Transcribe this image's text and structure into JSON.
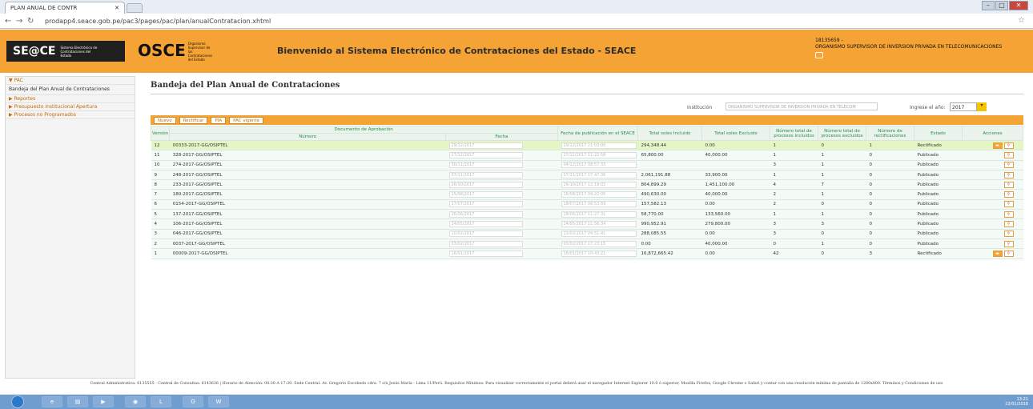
{
  "browser": {
    "tab_title": "PLAN ANUAL DE CONTR",
    "url": "prodapp4.seace.gob.pe/pac3/pages/pac/plan/anualContratacion.xhtml"
  },
  "banner": {
    "seace": "SE@CE",
    "seace_sub": "Sistema Electrónico de Contrataciones del Estado",
    "osce": "OSCE",
    "osce_sub": "Organismo Supervisor de las Contrataciones del Estado",
    "welcome": "Bienvenido al Sistema Electrónico de Contrataciones del Estado - SEACE",
    "user_id": "18135659 -",
    "entity": "ORGANISMO SUPERVISOR DE INVERSION PRIVADA EN TELECOMUNICACIONES"
  },
  "sidebar": {
    "items": [
      {
        "label": "▼ PAC"
      },
      {
        "label": "Bandeja del Plan Anual de Contrataciones"
      },
      {
        "label": "▶ Reportes"
      },
      {
        "label": "▶ Presupuesto Institucional Apertura"
      },
      {
        "label": "▶ Procesos no Programados"
      }
    ]
  },
  "page": {
    "title": "Bandeja del Plan Anual de Contrataciones",
    "inst_label": "Institución",
    "inst_value": "ORGANISMO SUPERVISOR DE INVERSION PRIVADA EN TELECOM",
    "anio_label": "Ingrese el año:",
    "anio_value": "2017"
  },
  "toolbar": {
    "nuevo": "Nuevo",
    "rectificar": "Rectificar",
    "pia": "PIA",
    "vigente": "PAC vigente"
  },
  "table": {
    "headers": {
      "version": "Versión",
      "doc": "Documento de Aprobación",
      "numero": "Número",
      "fecha": "Fecha",
      "pub": "Fecha de publicación en el SEACE",
      "incl": "Total soles Incluido",
      "excl": "Total soles Excluido",
      "nincl": "Número total de procesos incluidos",
      "nexcl": "Número total de procesos excluidos",
      "nrect": "Número de rectificaciones",
      "estado": "Estado",
      "acciones": "Acciones"
    },
    "rows": [
      {
        "v": "12",
        "num": "00333-2017-GG/OSIPTEL",
        "fecha": "29/12/2017",
        "pub": "29/12/2017 21:03:00",
        "inc": "294,348.44",
        "exc": "0.00",
        "ni": "1",
        "ne": "0",
        "nr": "1",
        "est": "Rectificado",
        "folder": true
      },
      {
        "v": "11",
        "num": "328-2017-GG/OSIPTEL",
        "fecha": "27/12/2017",
        "pub": "27/12/2017 11:22:58",
        "inc": "65,800.00",
        "exc": "40,000.00",
        "ni": "1",
        "ne": "1",
        "nr": "0",
        "est": "Publicado",
        "folder": false
      },
      {
        "v": "10",
        "num": "274-2017-GG/OSIPTEL",
        "fecha": "30/11/2017",
        "pub": "04/12/2017 08:57:33",
        "inc": "",
        "exc": "",
        "ni": "3",
        "ne": "1",
        "nr": "0",
        "est": "Publicado",
        "folder": false
      },
      {
        "v": "9",
        "num": "248-2017-GG/OSIPTEL",
        "fecha": "07/11/2017",
        "pub": "07/11/2017 17:47:36",
        "inc": "2,061,191.88",
        "exc": "33,900.00",
        "ni": "1",
        "ne": "1",
        "nr": "0",
        "est": "Publicado",
        "folder": false
      },
      {
        "v": "8",
        "num": "233-2017-GG/OSIPTEL",
        "fecha": "26/10/2017",
        "pub": "26/10/2017 12:19:02",
        "inc": "804,899.29",
        "exc": "1,451,100.00",
        "ni": "4",
        "ne": "7",
        "nr": "0",
        "est": "Publicado",
        "folder": false
      },
      {
        "v": "7",
        "num": "180-2017-GG/OSIPTEL",
        "fecha": "15/08/2017",
        "pub": "16/08/2017 09:22:05",
        "inc": "490,630.00",
        "exc": "40,000.00",
        "ni": "2",
        "ne": "1",
        "nr": "0",
        "est": "Publicado",
        "folder": false
      },
      {
        "v": "6",
        "num": "0154-2017-GG/OSIPTEL",
        "fecha": "17/07/2017",
        "pub": "18/07/2017 08:53:59",
        "inc": "157,582.13",
        "exc": "0.00",
        "ni": "2",
        "ne": "0",
        "nr": "0",
        "est": "Publicado",
        "folder": false
      },
      {
        "v": "5",
        "num": "137-2017-GG/OSIPTEL",
        "fecha": "26/06/2017",
        "pub": "28/06/2017 11:27:31",
        "inc": "58,770.00",
        "exc": "133,560.00",
        "ni": "1",
        "ne": "1",
        "nr": "0",
        "est": "Publicado",
        "folder": false
      },
      {
        "v": "4",
        "num": "106-2017-GG/OSIPTEL",
        "fecha": "24/05/2017",
        "pub": "24/05/2017 11:56:34",
        "inc": "990,952.91",
        "exc": "279,800.00",
        "ni": "3",
        "ne": "3",
        "nr": "0",
        "est": "Publicado",
        "folder": false
      },
      {
        "v": "3",
        "num": "046-2017-GG/OSIPTEL",
        "fecha": "10/02/2017",
        "pub": "13/02/2017 09:51:41",
        "inc": "288,085.55",
        "exc": "0.00",
        "ni": "3",
        "ne": "0",
        "nr": "0",
        "est": "Publicado",
        "folder": false
      },
      {
        "v": "2",
        "num": "0037-2017-GG/OSIPTEL",
        "fecha": "03/02/2017",
        "pub": "03/02/2017 17:23:15",
        "inc": "0.00",
        "exc": "40,000.00",
        "ni": "0",
        "ne": "1",
        "nr": "0",
        "est": "Publicado",
        "folder": false
      },
      {
        "v": "1",
        "num": "00009-2017-GG/OSIPTEL",
        "fecha": "16/01/2017",
        "pub": "16/01/2017 10:43:21",
        "inc": "16,872,665.42",
        "exc": "0.00",
        "ni": "42",
        "ne": "0",
        "nr": "3",
        "est": "Rectificado",
        "folder": true
      }
    ]
  },
  "footer": "Central Administrativa: 6135555 - Central de Consultas: 6143636 | Horario de Atención: 08:30 A 17:30. Sede Central: Av. Gregorio Escobedo cdra. 7 s/n Jesús María - Lima 11/Perú. Requisitos Mínimos: Para visualizar correctamente el portal deberá usar el navegador Internet Explorer 10.0 ó superior, Mozilla Firefox, Google Chrome o Safari y contar con una resolución mínima de pantalla de 1280x800. Términos y Condiciones de uso",
  "taskbar": {
    "time": "13:21",
    "date": "22/01/2018"
  }
}
